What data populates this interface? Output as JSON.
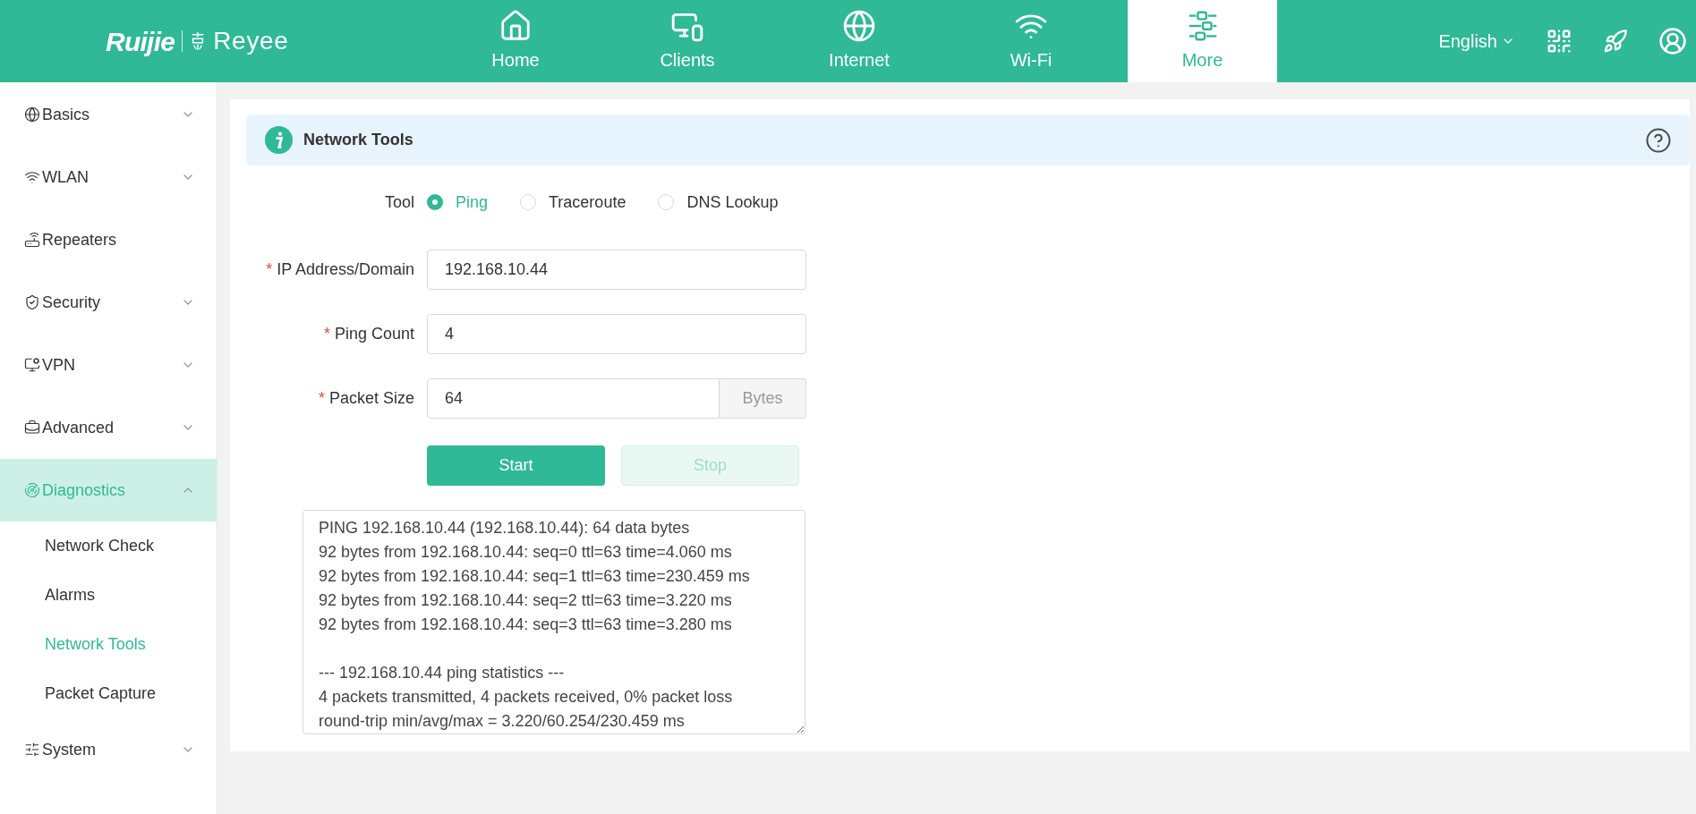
{
  "header": {
    "brand": "Ruijie",
    "product": "Reyee",
    "nav": [
      {
        "label": "Home",
        "selected": false
      },
      {
        "label": "Clients",
        "selected": false
      },
      {
        "label": "Internet",
        "selected": false
      },
      {
        "label": "Wi-Fi",
        "selected": false
      },
      {
        "label": "More",
        "selected": true
      }
    ],
    "language": "English"
  },
  "sidebar": {
    "items": [
      {
        "label": "Basics",
        "expandable": true,
        "expanded": false,
        "selected": false
      },
      {
        "label": "WLAN",
        "expandable": true,
        "expanded": false,
        "selected": false
      },
      {
        "label": "Repeaters",
        "expandable": false,
        "selected": false
      },
      {
        "label": "Security",
        "expandable": true,
        "expanded": false,
        "selected": false
      },
      {
        "label": "VPN",
        "expandable": true,
        "expanded": false,
        "selected": false
      },
      {
        "label": "Advanced",
        "expandable": true,
        "expanded": false,
        "selected": false
      },
      {
        "label": "Diagnostics",
        "expandable": true,
        "expanded": true,
        "selected": true,
        "children": [
          {
            "label": "Network Check",
            "selected": false
          },
          {
            "label": "Alarms",
            "selected": false
          },
          {
            "label": "Network Tools",
            "selected": true
          },
          {
            "label": "Packet Capture",
            "selected": false
          }
        ]
      },
      {
        "label": "System",
        "expandable": true,
        "expanded": false,
        "selected": false
      }
    ]
  },
  "banner": {
    "title": "Network Tools"
  },
  "form": {
    "tool_label": "Tool",
    "tools": [
      {
        "label": "Ping",
        "selected": true
      },
      {
        "label": "Traceroute",
        "selected": false
      },
      {
        "label": "DNS Lookup",
        "selected": false
      }
    ],
    "fields": [
      {
        "label": "IP Address/Domain",
        "required_mark": "*",
        "value": "192.168.10.44"
      },
      {
        "label": "Ping Count",
        "required_mark": "*",
        "value": "4"
      },
      {
        "label": "Packet Size",
        "required_mark": "*",
        "value": "64",
        "suffix": "Bytes"
      }
    ],
    "buttons": [
      {
        "label": "Start",
        "disabled": false
      },
      {
        "label": "Stop",
        "disabled": true
      }
    ],
    "output": {
      "reply_lines": [
        "PING 192.168.10.44 (192.168.10.44): 64 data bytes",
        "92 bytes from 192.168.10.44: seq=0 ttl=63 time=4.060 ms",
        "92 bytes from 192.168.10.44: seq=1 ttl=63 time=230.459 ms",
        "92 bytes from 192.168.10.44: seq=2 ttl=63 time=3.220 ms",
        "92 bytes from 192.168.10.44: seq=3 ttl=63 time=3.280 ms"
      ],
      "statistics_lines": [
        "--- 192.168.10.44 ping statistics ---",
        "4 packets transmitted, 4 packets received, 0% packet loss",
        "round-trip min/avg/max = 3.220/60.254/230.459 ms"
      ]
    }
  }
}
